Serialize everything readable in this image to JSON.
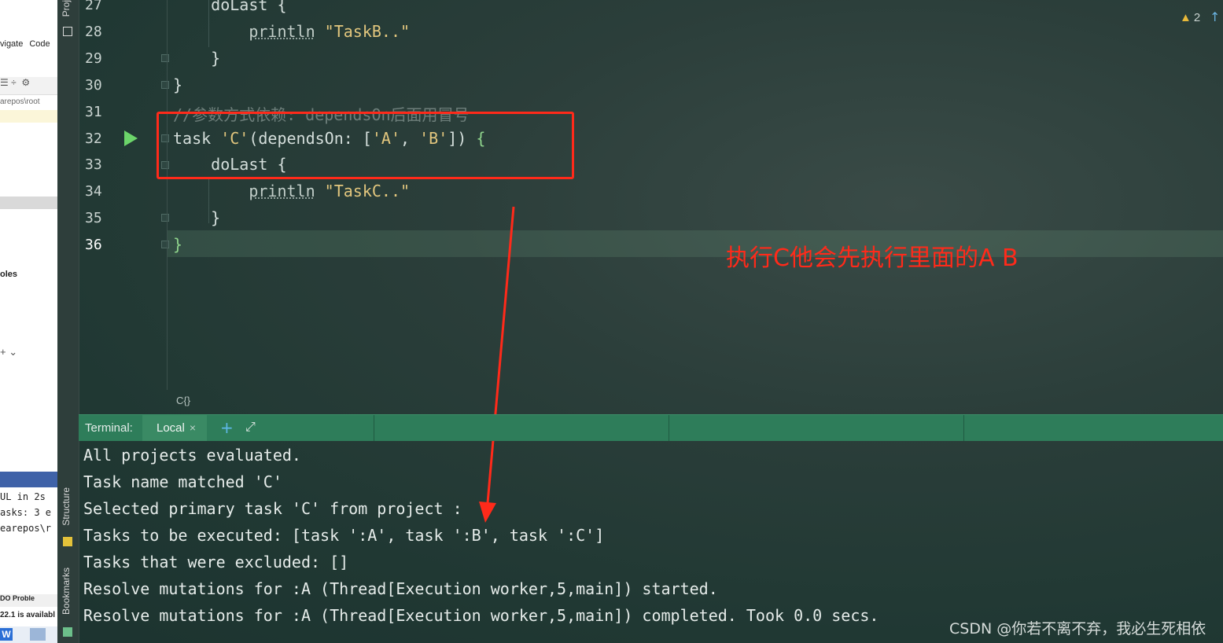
{
  "left_window": {
    "menu": [
      "vigate",
      "Code"
    ],
    "path_text": "arepos\\root",
    "roles_text": "oles",
    "term_lines": [
      "UL in 2s",
      "asks: 3 e",
      "earepos\\r"
    ],
    "status_text": "DO   Proble",
    "avail_text": "22.1 is availabl"
  },
  "tool_strip": {
    "project_tab": "Proj",
    "structure_tab": "Structure",
    "bookmarks_tab": "Bookmarks"
  },
  "editor": {
    "line_numbers": [
      "27",
      "28",
      "29",
      "30",
      "31",
      "32",
      "33",
      "34",
      "35",
      "36"
    ],
    "current_line": "36",
    "lines": {
      "l27": "    doLast {",
      "l28_fn": "println",
      "l28_str": "\"TaskB..\"",
      "l29": "    }",
      "l30": "}",
      "l31": "//参数方式依赖: dependsOn后面用冒号",
      "l32_pre": "task ",
      "l32_name": "'C'",
      "l32_mid": "(dependsOn: [",
      "l32_a": "'A'",
      "l32_sep": ", ",
      "l32_b": "'B'",
      "l32_end": "]) ",
      "l32_brace": "{",
      "l33": "    doLast {",
      "l34_fn": "println",
      "l34_str": "\"TaskC..\"",
      "l35": "    }",
      "l36": "}"
    },
    "warning_count": "2",
    "breadcrumb": "C{}"
  },
  "annotation": {
    "text": "执行C他会先执行里面的A B",
    "color": "#ff2a1a"
  },
  "terminal": {
    "label": "Terminal:",
    "tab": "Local",
    "close": "×",
    "add": "+",
    "expand": "⤢",
    "lines": [
      "All projects evaluated.",
      "Task name matched 'C'",
      "Selected primary task 'C' from project :",
      "Tasks to be executed: [task ':A', task ':B', task ':C']",
      "Tasks that were excluded: []",
      "Resolve mutations for :A (Thread[Execution worker,5,main]) started.",
      "Resolve mutations for :A (Thread[Execution worker,5,main]) completed. Took 0.0 secs."
    ]
  },
  "watermark": "CSDN @你若不离不弃，我必生死相依"
}
